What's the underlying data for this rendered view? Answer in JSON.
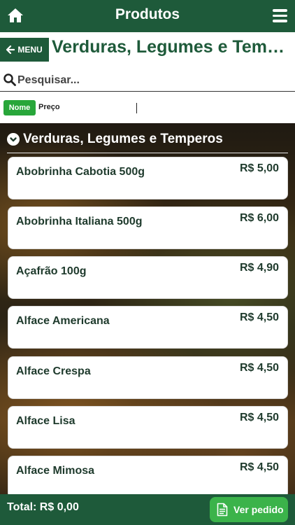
{
  "header": {
    "title": "Produtos",
    "home_icon": "home-icon",
    "menu_icon": "hamburger-icon"
  },
  "nav": {
    "menu_label": "MENU",
    "category_title": "Verduras, Legumes e Temperos"
  },
  "search": {
    "placeholder": "Pesquisar...",
    "value": ""
  },
  "sort": {
    "nome_label": "Nome",
    "preco_label": "Preço",
    "active": "Nome"
  },
  "section": {
    "title": "Verduras, Legumes e Temperos"
  },
  "products": [
    {
      "name": "Abobrinha Cabotia 500g",
      "price": "R$ 5,00"
    },
    {
      "name": "Abobrinha Italiana 500g",
      "price": "R$ 6,00"
    },
    {
      "name": "Açafrão 100g",
      "price": "R$ 4,90"
    },
    {
      "name": "Alface Americana",
      "price": "R$ 4,50"
    },
    {
      "name": "Alface Crespa",
      "price": "R$ 4,50"
    },
    {
      "name": "Alface Lisa",
      "price": "R$ 4,50"
    },
    {
      "name": "Alface Mimosa",
      "price": "R$ 4,50"
    }
  ],
  "footer": {
    "total_label": "Total: R$ 0,00",
    "order_button": "Ver pedido"
  },
  "colors": {
    "brand_green": "#1e5a3a",
    "button_green": "#3bb34a",
    "sort_active": "#28a63a"
  }
}
